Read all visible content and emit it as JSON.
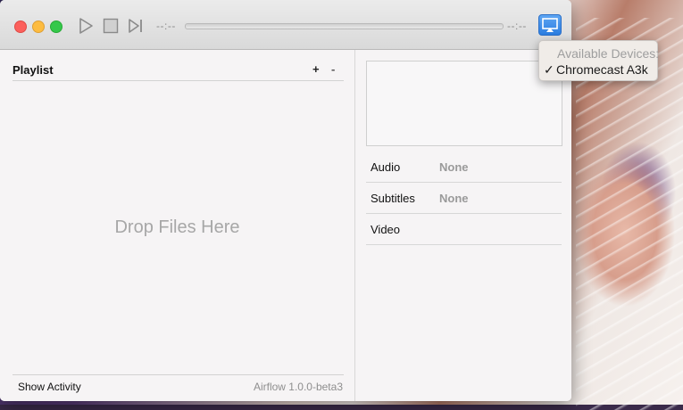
{
  "window": {
    "time_elapsed": "--:--",
    "time_remaining": "--:--"
  },
  "toolbar": {
    "play_icon": "play-icon",
    "stop_icon": "stop-icon",
    "next_icon": "skip-forward-icon",
    "airplay_icon": "airplay-icon",
    "seek_progress": 0
  },
  "devices_menu": {
    "header": "Available Devices:",
    "items": [
      {
        "label": "Chromecast A3k",
        "checked": true,
        "check_mark": "✓"
      }
    ]
  },
  "playlist": {
    "title": "Playlist",
    "add_label": "+",
    "remove_label": "-",
    "empty_text": "Drop Files Here"
  },
  "footer": {
    "show_activity": "Show Activity",
    "version": "Airflow 1.0.0-beta3"
  },
  "tracks": {
    "rows": [
      {
        "label": "Audio",
        "value": "None"
      },
      {
        "label": "Subtitles",
        "value": "None"
      },
      {
        "label": "Video",
        "value": ""
      }
    ]
  },
  "colors": {
    "close": "#fc605c",
    "minimize": "#fdbc40",
    "maximize": "#34c84a",
    "airplay_active": "#2b7de0"
  }
}
